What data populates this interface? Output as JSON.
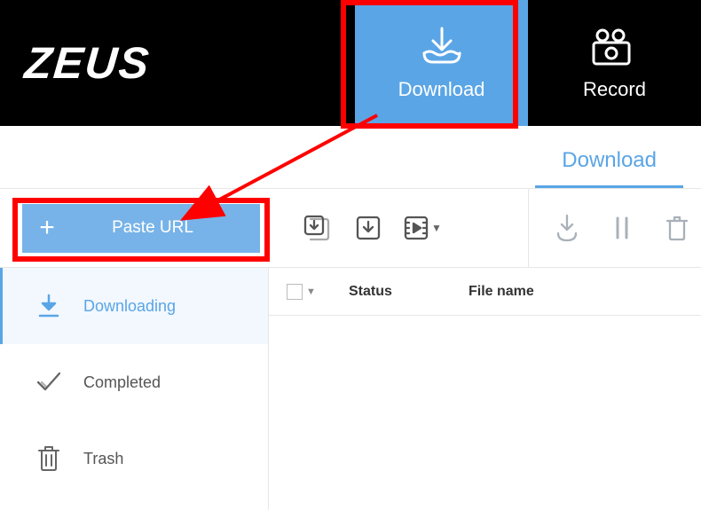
{
  "app": {
    "logo": "ZEUS"
  },
  "header": {
    "tabs": [
      {
        "label": "Download",
        "active": true
      },
      {
        "label": "Record",
        "active": false
      }
    ]
  },
  "subheader": {
    "active_tab": "Download"
  },
  "toolbar": {
    "paste_url_label": "Paste URL",
    "icons": {
      "batch_download": "batch-download-icon",
      "download_one": "download-single-icon",
      "convert": "convert-icon",
      "resume": "resume-icon",
      "pause": "pause-icon",
      "delete": "delete-icon"
    }
  },
  "sidebar": {
    "items": [
      {
        "label": "Downloading",
        "icon": "download-arrow-icon",
        "active": true
      },
      {
        "label": "Completed",
        "icon": "check-icon",
        "active": false
      },
      {
        "label": "Trash",
        "icon": "trash-icon",
        "active": false
      }
    ]
  },
  "table": {
    "columns": {
      "status": "Status",
      "filename": "File name"
    },
    "rows": []
  },
  "colors": {
    "accent": "#5aa5e6",
    "accent_light": "#77b3e8",
    "highlight": "#ff0000"
  }
}
